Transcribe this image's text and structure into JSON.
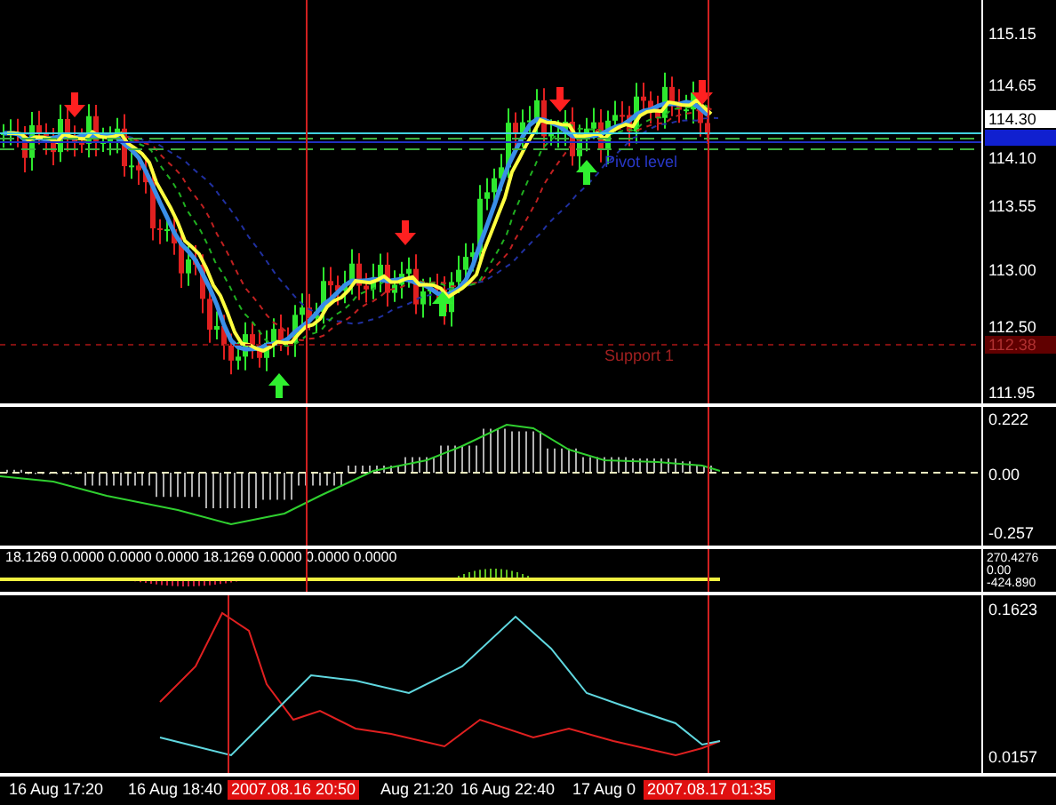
{
  "main_pane": {
    "price_scale": [
      "115.15",
      "114.65",
      "114.10",
      "113.55",
      "113.00",
      "112.50",
      "111.95"
    ],
    "bid_label": "114.30",
    "support_price": "112.38",
    "line_labels": [
      {
        "kind": "pivot",
        "text": "Pivot level"
      },
      {
        "kind": "support",
        "text": "Support 1"
      }
    ]
  },
  "macd_pane": {
    "scale": [
      "0.222",
      "0.00",
      "-0.257"
    ]
  },
  "oscillator_pane": {
    "values": "18.1269 0.0000 0.0000 0.0000 18.1269 0.0000 0.0000 0.0000",
    "scale": [
      "270.4276",
      "0.00",
      "-424.890"
    ]
  },
  "lower_pane": {
    "scale": [
      "0.1623",
      "0.0157"
    ]
  },
  "time_axis": [
    {
      "text": "16 Aug 17:20",
      "highlighted": false
    },
    {
      "text": "16 Aug 18:40",
      "highlighted": false
    },
    {
      "text": "2007.08.16 20:50",
      "highlighted": true
    },
    {
      "text": "Aug 21:20",
      "highlighted": false
    },
    {
      "text": "16 Aug 22:40",
      "highlighted": false
    },
    {
      "text": "17 Aug 0",
      "highlighted": false
    },
    {
      "text": "2007.08.17 01:35",
      "highlighted": true
    }
  ]
}
